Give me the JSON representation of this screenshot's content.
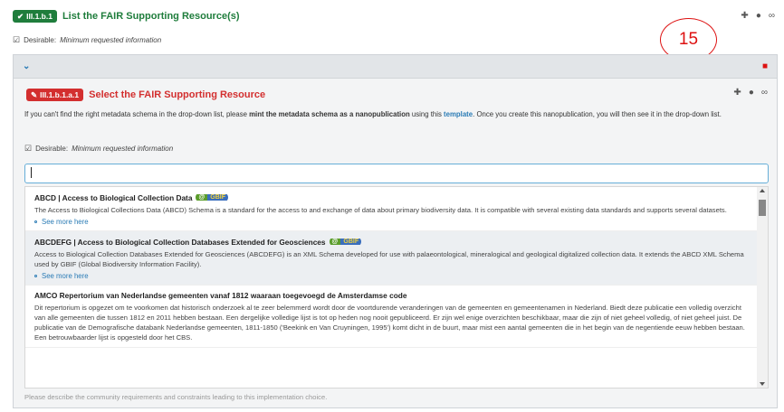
{
  "outer": {
    "badge": "III.1.b.1",
    "title": "List the FAIR Supporting Resource(s)",
    "desirable_prefix": "Desirable:",
    "desirable_text": "Minimum requested information"
  },
  "marker": {
    "number": "15"
  },
  "inner": {
    "badge": "III.1.b.1.a.1",
    "title": "Select the FAIR Supporting Resource",
    "instructions": {
      "part1": "If you can't find the right metadata schema in the drop-down list, please ",
      "bold": "mint the metadata schema as a nanopublication",
      "part2": " using this ",
      "link": "template",
      "part3": ". Once you create this nanopublication, you will then see it in the drop-down list."
    },
    "desirable_prefix": "Desirable:",
    "desirable_text": "Minimum requested information"
  },
  "search": {
    "value": ""
  },
  "options": [
    {
      "title": "ABCD | Access to Biological Collection Data",
      "logo": "GBIF",
      "desc": "The Access to Biological Collections Data (ABCD) Schema is a standard for the access to and exchange of data about primary biodiversity data. It is compatible with several existing data standards and supports several datasets.",
      "see_more": "See more here"
    },
    {
      "title": "ABCDEFG | Access to Biological Collection Databases Extended for Geosciences",
      "logo": "GBIF",
      "desc": "Access to Biological Collection Databases Extended for Geosciences (ABCDEFG) is an XML Schema developed for use with palaeontological, mineralogical and geological digitalized collection data. It extends the ABCD XML Schema used by GBIF (Global Biodiversity Information Facility).",
      "see_more": "See more here"
    },
    {
      "title": "AMCO Repertorium van Nederlandse gemeenten vanaf 1812 waaraan toegevoegd de Amsterdamse code",
      "desc": "Dit repertorium is opgezet om te voorkomen dat historisch onderzoek al te zeer belemmerd wordt door de voortdurende veranderingen van de gemeenten en gemeentenamen in Nederland. Biedt deze publicatie een volledig overzicht van alle gemeenten die tussen 1812 en 2011 hebben bestaan. Een dergelijke volledige lijst is tot op heden nog nooit gepubliceerd. Er zijn wel enige overzichten beschikbaar, maar die zijn of niet geheel volledig, of niet geheel juist. De publicatie van de Demografische databank Nederlandse gemeenten, 1811-1850 ('Beekink en Van Cruyningen, 1995') komt dicht in de buurt, maar mist een aantal gemeenten die in het begin van de negentiende eeuw hebben bestaan. Een betrouwbaarder lijst is opgesteld door het CBS."
    }
  ],
  "footer_hint": "Please describe the community requirements and constraints leading to this implementation choice.",
  "icons": {
    "check": "✔",
    "checkbox": "☑",
    "plus": "+",
    "comment": "●",
    "link": "🔗",
    "chevron": "⌄",
    "trash": "🗑",
    "pencil": "✎"
  }
}
